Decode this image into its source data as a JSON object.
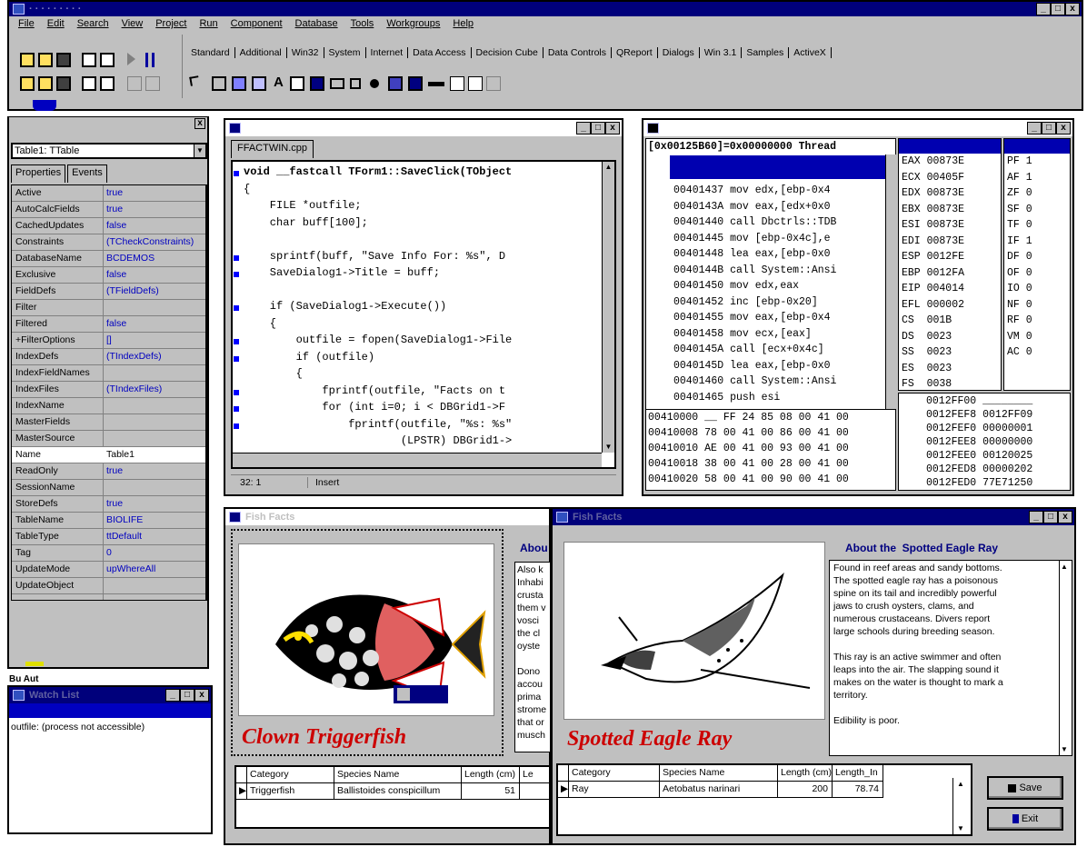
{
  "menu": [
    "File",
    "Edit",
    "Search",
    "View",
    "Project",
    "Run",
    "Component",
    "Database",
    "Tools",
    "Workgroups",
    "Help"
  ],
  "main_window_buttons": [
    "_",
    "□",
    "x"
  ],
  "palette_tabs": [
    "Standard",
    "Additional",
    "Win32",
    "System",
    "Internet",
    "Data Access",
    "Decision Cube",
    "Data Controls",
    "QReport",
    "Dialogs",
    "Win 3.1",
    "Samples",
    "ActiveX"
  ],
  "object_inspector": {
    "object": "Table1: TTable",
    "tabs": [
      "Properties",
      "Events"
    ],
    "rows": [
      {
        "name": "Active",
        "value": "true"
      },
      {
        "name": "AutoCalcFields",
        "value": "true"
      },
      {
        "name": "CachedUpdates",
        "value": "false"
      },
      {
        "name": "Constraints",
        "value": "(TCheckConstraints)"
      },
      {
        "name": "DatabaseName",
        "value": "BCDEMOS"
      },
      {
        "name": "Exclusive",
        "value": "false"
      },
      {
        "name": "FieldDefs",
        "value": "(TFieldDefs)"
      },
      {
        "name": "Filter",
        "value": ""
      },
      {
        "name": "Filtered",
        "value": "false"
      },
      {
        "name": "+FilterOptions",
        "value": "[]"
      },
      {
        "name": "IndexDefs",
        "value": "(TIndexDefs)"
      },
      {
        "name": "IndexFieldNames",
        "value": ""
      },
      {
        "name": "IndexFiles",
        "value": "(TIndexFiles)"
      },
      {
        "name": "IndexName",
        "value": ""
      },
      {
        "name": "MasterFields",
        "value": ""
      },
      {
        "name": "MasterSource",
        "value": ""
      },
      {
        "name": "Name",
        "value": "Table1"
      },
      {
        "name": "ReadOnly",
        "value": "true"
      },
      {
        "name": "SessionName",
        "value": ""
      },
      {
        "name": "StoreDefs",
        "value": "true"
      },
      {
        "name": "TableName",
        "value": "BIOLIFE"
      },
      {
        "name": "TableType",
        "value": "ttDefault"
      },
      {
        "name": "Tag",
        "value": "0"
      },
      {
        "name": "UpdateMode",
        "value": "upWhereAll"
      },
      {
        "name": "UpdateObject",
        "value": ""
      }
    ]
  },
  "editor": {
    "tab": "FFACTWIN.cpp",
    "lines": [
      "void __fastcall TForm1::SaveClick(TObject",
      "{",
      "    FILE *outfile;",
      "    char buff[100];",
      "",
      "    sprintf(buff, \"Save Info For: %s\", D",
      "    SaveDialog1->Title = buff;",
      "",
      "    if (SaveDialog1->Execute())",
      "    {",
      "        outfile = fopen(SaveDialog1->File",
      "        if (outfile)",
      "        {",
      "            fprintf(outfile, \"Facts on t",
      "            for (int i=0; i < DBGrid1->F",
      "                fprintf(outfile, \"%s: %s\"",
      "                        (LPSTR) DBGrid1->"
    ],
    "status_pos": "32: 1",
    "status_mode": "Insert"
  },
  "cpu": {
    "header": "[0x00125B60]=0x00000000 Thread",
    "disasm": [
      "00401437 mov edx,[ebp-0x4",
      "0040143A mov eax,[edx+0x0",
      "00401440 call Dbctrls::TDB",
      "00401445 mov [ebp-0x4c],e",
      "00401448 lea eax,[ebp-0x0",
      "0040144B call System::Ansi",
      "00401450 mov edx,eax",
      "00401452 inc [ebp-0x20]",
      "00401455 mov eax,[ebp-0x4",
      "00401458 mov ecx,[eax]",
      "0040145A call [ecx+0x4c]",
      "0040145D lea eax,[ebp-0x0",
      "00401460 call System::Ansi",
      "00401465 push esi"
    ],
    "registers": [
      "EAX 00873E",
      "ECX 00405F",
      "EDX 00873E",
      "EBX 00873E",
      "ESI 00873E",
      "EDI 00873E",
      "ESP 0012FE",
      "EBP 0012FA",
      "EIP 004014",
      "EFL 000002",
      "CS  001B",
      "DS  0023",
      "SS  0023",
      "ES  0023",
      "FS  0038"
    ],
    "flags": [
      "PF 1",
      "AF 1",
      "ZF 0",
      "SF 0",
      "TF 0",
      "IF 1",
      "DF 0",
      "OF 0",
      "IO 0",
      "NF 0",
      "RF 0",
      "VM 0",
      "AC 0"
    ],
    "dump": [
      "00410000 __ FF 24 85 08 00 41 00",
      "00410008 78 00 41 00 86 00 41 00",
      "00410010 AE 00 41 00 93 00 41 00",
      "00410018 38 00 41 00 28 00 41 00",
      "00410020 58 00 41 00 90 00 41 00"
    ],
    "stack": [
      "0012FF00 ________",
      "0012FEF8 0012FF09",
      "0012FEF0 00000001",
      "0012FEE8 00000000",
      "0012FEE0 00120025",
      "0012FED8 00000202",
      "0012FED0 77E71250"
    ]
  },
  "watch": {
    "title": "Watch List",
    "entry": "outfile: (process not accessible)",
    "side_label": "Bu Aut"
  },
  "fish1": {
    "title": "Fish Facts",
    "name": "Clown Triggerfish",
    "about_label": "Abou",
    "memo_lines": [
      "Also k",
      "Inhabi",
      "crusta",
      "them v",
      "vosci",
      "the cl",
      "oyste",
      "",
      "Dono",
      "accou",
      "prima",
      "strome",
      "that or",
      "musch"
    ],
    "grid": {
      "headers": [
        "Category",
        "Species Name",
        "Length (cm)",
        "Le"
      ],
      "row": [
        "Triggerfish",
        "Ballistoides conspicillum",
        "51",
        ""
      ]
    }
  },
  "fish2": {
    "title": "Fish Facts",
    "name": "Spotted Eagle Ray",
    "about_title": "About the  Spotted Eagle Ray",
    "memo": [
      "Found in reef areas and sandy bottoms.",
      "The spotted eagle ray has a poisonous",
      "spine on its tail and incredibly powerful",
      "jaws to crush oysters, clams, and",
      "numerous crustaceans.  Divers report",
      "large schools during breeding season.",
      "",
      "This ray is an active swimmer and often",
      "leaps into the air.  The slapping sound it",
      "makes on the water is thought to mark a",
      "territory.",
      "",
      "Edibility is poor."
    ],
    "grid": {
      "headers": [
        "Category",
        "Species Name",
        "Length (cm)",
        "Length_In"
      ],
      "row": [
        "Ray",
        "Aetobatus narinari",
        "200",
        "78.74"
      ]
    },
    "save_label": "Save",
    "exit_label": "Exit"
  },
  "colors": {
    "titlebar": "#00007b",
    "face": "#c0c0c0",
    "value_blue": "#0000c0",
    "fish_red": "#cc0000"
  }
}
